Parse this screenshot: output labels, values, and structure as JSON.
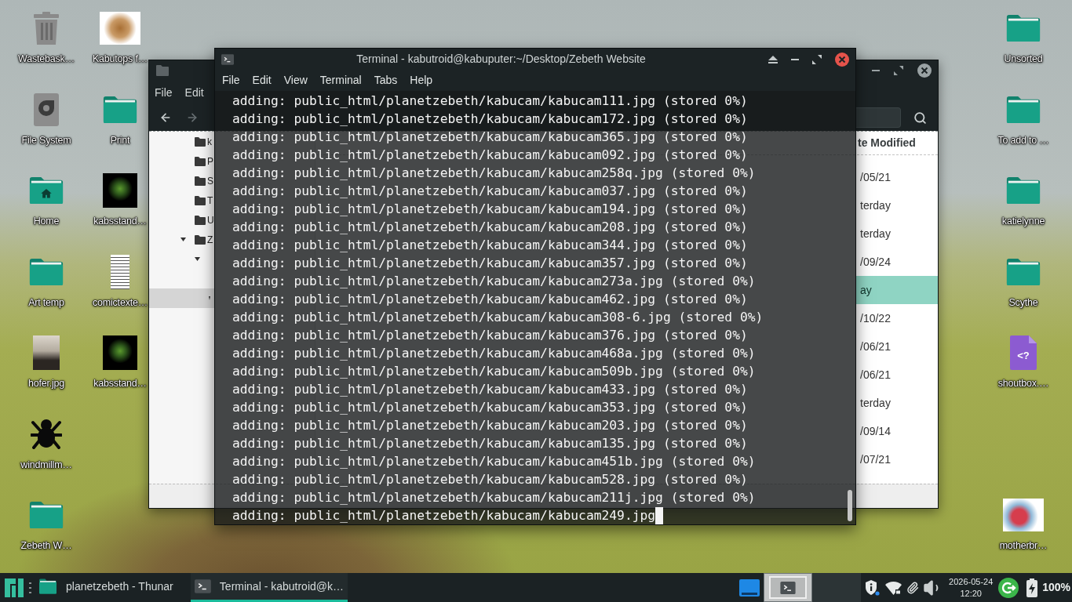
{
  "desktop": {
    "left_columns": [
      [
        {
          "label": "Wastebask…",
          "kind": "trash"
        },
        {
          "label": "File System",
          "kind": "drive"
        },
        {
          "label": "Home",
          "kind": "home"
        },
        {
          "label": "Art temp",
          "kind": "folder"
        },
        {
          "label": "hofer.jpg",
          "kind": "portrait"
        },
        {
          "label": "windmillm…",
          "kind": "sprite"
        },
        {
          "label": "Zebeth W…",
          "kind": "folder"
        }
      ],
      [
        {
          "label": "Kabutops f…",
          "kind": "image_light"
        },
        {
          "label": "Print",
          "kind": "folder"
        },
        {
          "label": "kabsstand…",
          "kind": "image_dark"
        },
        {
          "label": "comictexte…",
          "kind": "document_image"
        },
        {
          "label": "kabsstand…",
          "kind": "image_dark"
        }
      ]
    ],
    "right_column": {
      "top": [
        {
          "label": "Unsorted",
          "kind": "folder"
        },
        {
          "label": "To add to …",
          "kind": "folder"
        },
        {
          "label": "katielynne",
          "kind": "folder"
        },
        {
          "label": "Scythe",
          "kind": "folder"
        },
        {
          "label": "shoutbox.…",
          "kind": "php",
          "glyph": "<?"
        }
      ],
      "bottom": [
        {
          "label": "motherbr…",
          "kind": "image_jar"
        }
      ]
    }
  },
  "file_manager": {
    "menu": [
      "File",
      "Edit"
    ],
    "sidebar": [
      {
        "label": "k",
        "selected": false
      },
      {
        "label": "P",
        "selected": false
      },
      {
        "label": "S",
        "selected": false
      },
      {
        "label": "T",
        "selected": false
      },
      {
        "label": "U",
        "selected": false
      },
      {
        "label": "Z",
        "selected": false,
        "expanded": true,
        "children": [
          {
            "selected": false,
            "expanded": true,
            "children": [
              {
                "selected": false
              },
              {
                "selected": true,
                "expanded": true
              }
            ]
          }
        ]
      }
    ],
    "list": {
      "header": "te Modified",
      "rows": [
        {
          "cell": "/05/21",
          "selected": false
        },
        {
          "cell": "terday",
          "selected": false
        },
        {
          "cell": "terday",
          "selected": false
        },
        {
          "cell": "/09/24",
          "selected": false
        },
        {
          "cell": "ay",
          "selected": true
        },
        {
          "cell": "/10/22",
          "selected": false
        },
        {
          "cell": "/06/21",
          "selected": false
        },
        {
          "cell": "/06/21",
          "selected": false
        },
        {
          "cell": "terday",
          "selected": false
        },
        {
          "cell": "/09/14",
          "selected": false
        },
        {
          "cell": "/07/21",
          "selected": false
        }
      ]
    }
  },
  "terminal": {
    "title": "Terminal - kabutroid@kabuputer:~/Desktop/Zebeth Website",
    "menu": [
      "File",
      "Edit",
      "View",
      "Terminal",
      "Tabs",
      "Help"
    ],
    "lines": [
      "adding: public_html/planetzebeth/kabucam/kabucam111.jpg (stored 0%)",
      "adding: public_html/planetzebeth/kabucam/kabucam172.jpg (stored 0%)",
      "adding: public_html/planetzebeth/kabucam/kabucam365.jpg (stored 0%)",
      "adding: public_html/planetzebeth/kabucam/kabucam092.jpg (stored 0%)",
      "adding: public_html/planetzebeth/kabucam/kabucam258q.jpg (stored 0%)",
      "adding: public_html/planetzebeth/kabucam/kabucam037.jpg (stored 0%)",
      "adding: public_html/planetzebeth/kabucam/kabucam194.jpg (stored 0%)",
      "adding: public_html/planetzebeth/kabucam/kabucam208.jpg (stored 0%)",
      "adding: public_html/planetzebeth/kabucam/kabucam344.jpg (stored 0%)",
      "adding: public_html/planetzebeth/kabucam/kabucam357.jpg (stored 0%)",
      "adding: public_html/planetzebeth/kabucam/kabucam273a.jpg (stored 0%)",
      "adding: public_html/planetzebeth/kabucam/kabucam462.jpg (stored 0%)",
      "adding: public_html/planetzebeth/kabucam/kabucam308-6.jpg (stored 0%)",
      "adding: public_html/planetzebeth/kabucam/kabucam376.jpg (stored 0%)",
      "adding: public_html/planetzebeth/kabucam/kabucam468a.jpg (stored 0%)",
      "adding: public_html/planetzebeth/kabucam/kabucam509b.jpg (stored 0%)",
      "adding: public_html/planetzebeth/kabucam/kabucam433.jpg (stored 0%)",
      "adding: public_html/planetzebeth/kabucam/kabucam353.jpg (stored 0%)",
      "adding: public_html/planetzebeth/kabucam/kabucam203.jpg (stored 0%)",
      "adding: public_html/planetzebeth/kabucam/kabucam135.jpg (stored 0%)",
      "adding: public_html/planetzebeth/kabucam/kabucam451b.jpg (stored 0%)",
      "adding: public_html/planetzebeth/kabucam/kabucam528.jpg (stored 0%)",
      "adding: public_html/planetzebeth/kabucam/kabucam211j.jpg (stored 0%)",
      "adding: public_html/planetzebeth/kabucam/kabucam249.jpg"
    ]
  },
  "taskbar": {
    "tasks": [
      {
        "label": "planetzebeth - Thunar",
        "kind": "folder",
        "selected": false
      },
      {
        "label": "Terminal - kabutroid@k…",
        "kind": "terminal",
        "selected": true
      }
    ],
    "workspaces": [
      {
        "selected": true,
        "has_window": true
      },
      {
        "selected": false,
        "has_window": false
      }
    ],
    "clock": {
      "date": "2026-05-24",
      "time": "12:20"
    },
    "battery": "100%"
  }
}
